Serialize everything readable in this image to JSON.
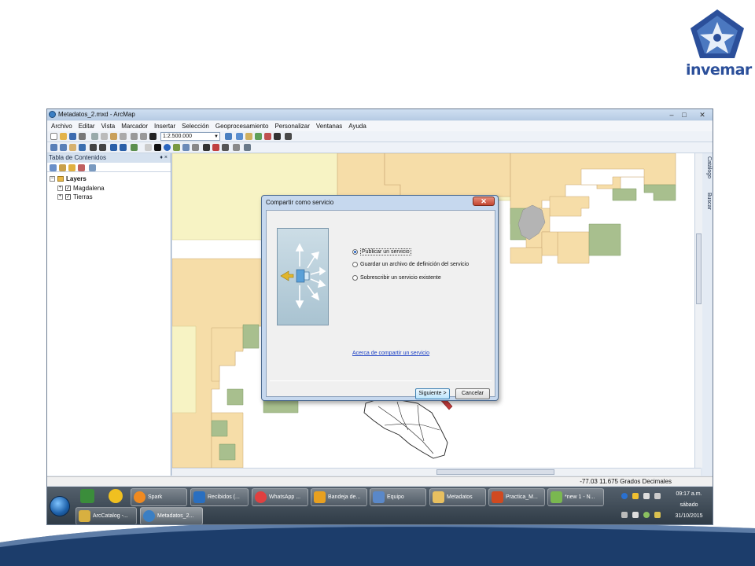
{
  "logo": {
    "word": "invemar",
    "colors": {
      "primary": "#2b4f9a",
      "secondary": "#6fa0dc"
    }
  },
  "window": {
    "title": "Metadatos_2.mxd - ArcMap",
    "controls": {
      "minimize": "–",
      "maximize": "□",
      "close": "✕"
    }
  },
  "menu": [
    "Archivo",
    "Editar",
    "Vista",
    "Marcador",
    "Insertar",
    "Selección",
    "Geoprocesamiento",
    "Personalizar",
    "Ventanas",
    "Ayuda"
  ],
  "toolbar": {
    "scale": "1:2.500.000"
  },
  "toc": {
    "title": "Tabla de Contenidos",
    "pin": "♦ ×",
    "root": "Layers",
    "layers": [
      "Magdalena",
      "Tierras"
    ]
  },
  "right_dock": {
    "tabs": [
      "Catálogo",
      "Buscar"
    ]
  },
  "status": {
    "coordinates": "-77.03  11.675 Grados Decimales"
  },
  "dialog": {
    "title": "Compartir como servicio",
    "close": "✕",
    "options": [
      {
        "label": "Publicar un servicio",
        "selected": true
      },
      {
        "label": "Guardar un archivo de definición del servicio",
        "selected": false
      },
      {
        "label": "Sobrescribir un servicio existente",
        "selected": false
      }
    ],
    "link": "Acerca de compartir un servicio",
    "next_button": "Siguiente >",
    "cancel_button": "Cancelar"
  },
  "taskbar": {
    "top_row": [
      "Spark",
      "Recibidos (...",
      "WhatsApp ...",
      "Bandeja de...",
      "Equipo",
      "Metadatos",
      "Practica_M...",
      "*new  1 - N..."
    ],
    "bottom_row": [
      "ArcCatalog -...",
      "Metadatos_2..."
    ],
    "clock_time": "09:17 a.m.",
    "clock_day": "sábado",
    "clock_date": "31/10/2015"
  },
  "colors": {
    "map_peach": "#f6dda8",
    "map_cream": "#f7f3c4",
    "map_green": "#a8bf8e",
    "map_gray": "#b4b4b4",
    "wave_navy": "#1c3d6b"
  }
}
